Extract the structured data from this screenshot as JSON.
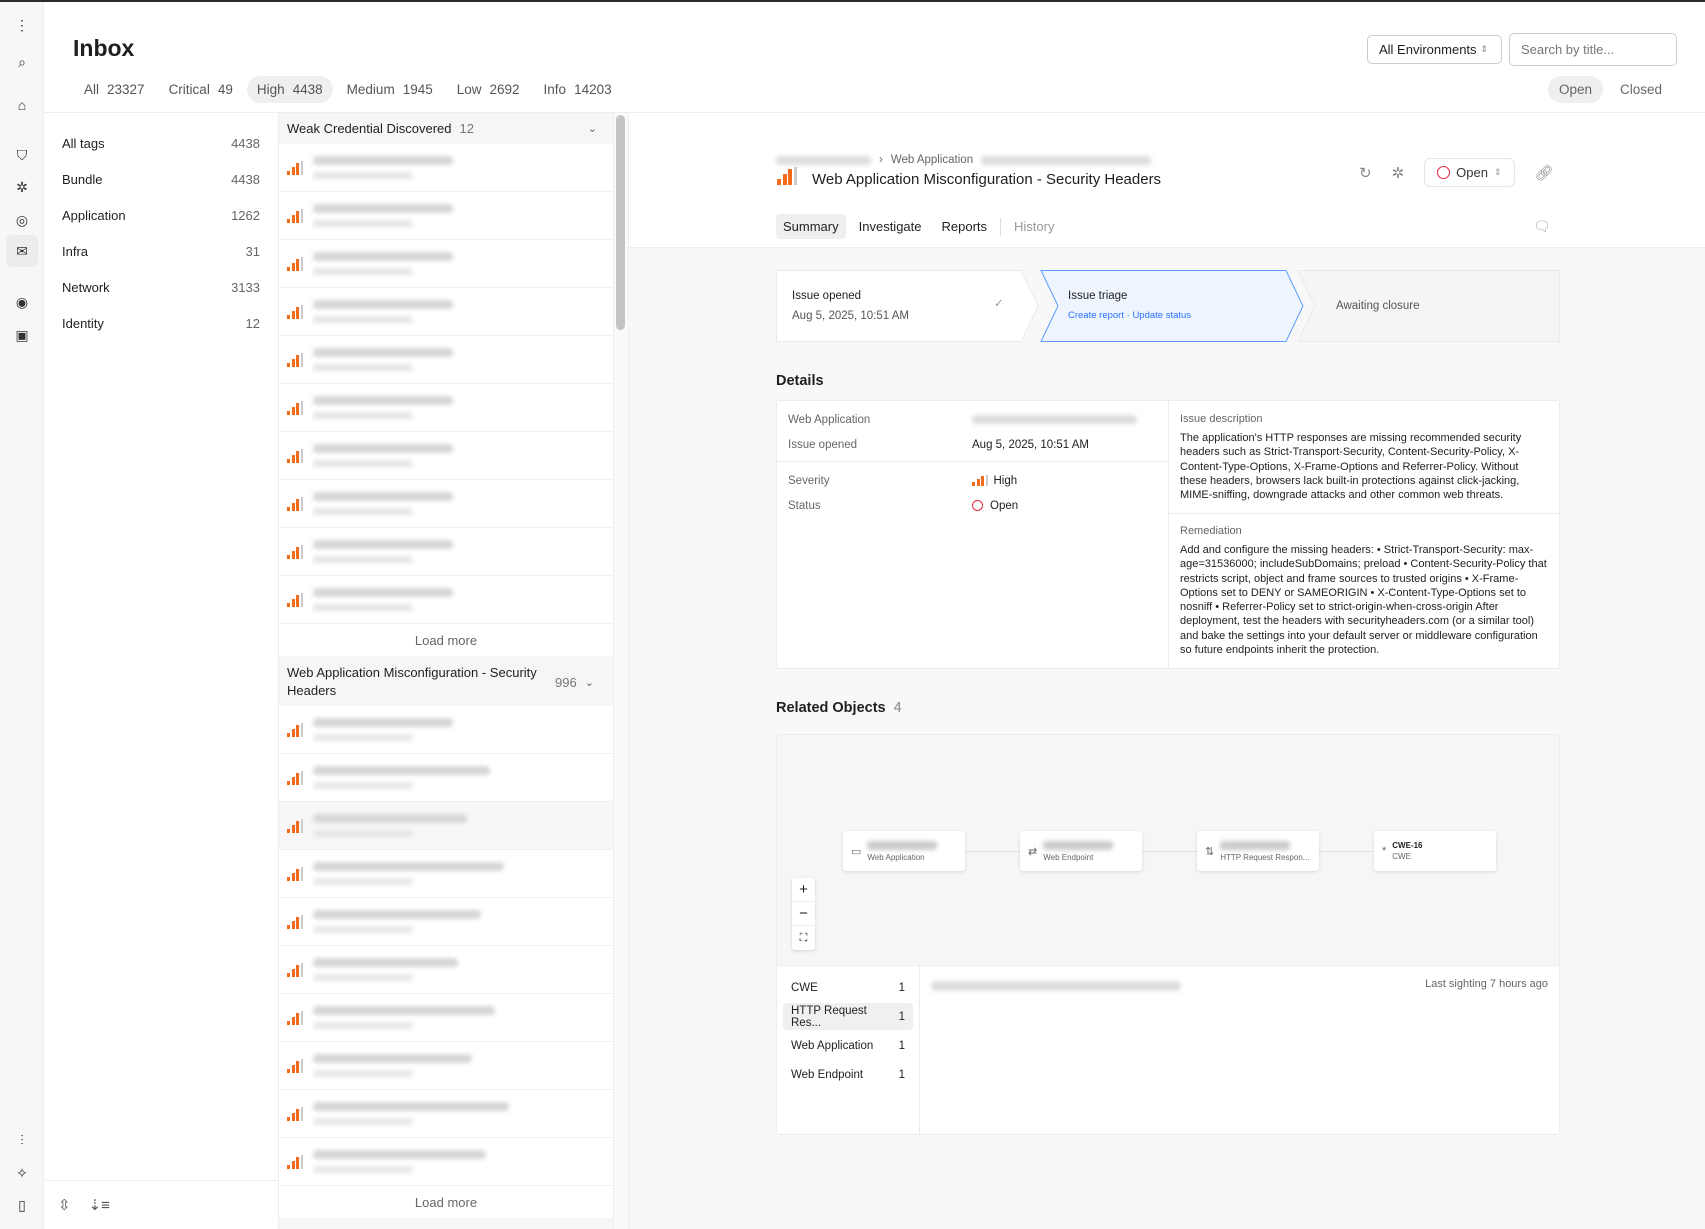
{
  "header": {
    "title": "Inbox",
    "environment": "All Environments",
    "search_placeholder": "Search by title...",
    "open_label": "Open",
    "closed_label": "Closed"
  },
  "severity_tabs": [
    {
      "label": "All",
      "count": "23327"
    },
    {
      "label": "Critical",
      "count": "49"
    },
    {
      "label": "High",
      "count": "4438"
    },
    {
      "label": "Medium",
      "count": "1945"
    },
    {
      "label": "Low",
      "count": "2692"
    },
    {
      "label": "Info",
      "count": "14203"
    }
  ],
  "tags": [
    {
      "label": "All tags",
      "count": "4438"
    },
    {
      "label": "Bundle",
      "count": "4438"
    },
    {
      "label": "Application",
      "count": "1262"
    },
    {
      "label": "Infra",
      "count": "31"
    },
    {
      "label": "Network",
      "count": "3133"
    },
    {
      "label": "Identity",
      "count": "12"
    }
  ],
  "groups": [
    {
      "title": "Weak Credential Discovered",
      "count": "12",
      "load_more": "Load more"
    },
    {
      "title": "Web Application Misconfiguration - Security Headers",
      "count": "996",
      "load_more": "Load more"
    }
  ],
  "colors": {
    "severity_high": "#f26b1d",
    "status_open": "#e2263f",
    "link": "#2970ff"
  },
  "detail": {
    "breadcrumb": "Web Application",
    "title": "Web Application Misconfiguration - Security Headers",
    "status": "Open",
    "tabs": [
      "Summary",
      "Investigate",
      "Reports",
      "History"
    ],
    "steps": {
      "opened_label": "Issue opened",
      "opened_date": "Aug 5, 2025, 10:51 AM",
      "triage_label": "Issue triage",
      "create_report": "Create report",
      "update_status": "Update status",
      "closure_label": "Awaiting closure"
    },
    "details_heading": "Details",
    "fields": {
      "web_app_label": "Web Application",
      "issue_opened_label": "Issue opened",
      "issue_opened_value": "Aug 5, 2025, 10:51 AM",
      "severity_label": "Severity",
      "severity_value": "High",
      "status_label": "Status",
      "status_value": "Open"
    },
    "description_label": "Issue description",
    "description": "The application's HTTP responses are missing recommended security headers such as Strict-Transport-Security, Content-Security-Policy, X-Content-Type-Options, X-Frame-Options and Referrer-Policy. Without these headers, browsers lack built-in protections against click-jacking, MIME-sniffing, downgrade attacks and other common web threats.",
    "remediation_label": "Remediation",
    "remediation": "Add and configure the missing headers: • Strict-Transport-Security: max-age=31536000; includeSubDomains; preload • Content-Security-Policy that restricts script, object and frame sources to trusted origins • X-Frame-Options set to DENY or SAMEORIGIN • X-Content-Type-Options set to nosniff • Referrer-Policy set to strict-origin-when-cross-origin After deployment, test the headers with securityheaders.com (or a similar tool) and bake the settings into your default server or middleware configuration so future endpoints inherit the protection.",
    "related_heading": "Related Objects",
    "related_count": "4",
    "graph_nodes": [
      {
        "type": "Web Application"
      },
      {
        "type": "Web Endpoint"
      },
      {
        "type": "HTTP Request Respon..."
      },
      {
        "title": "CWE-16",
        "type": "CWE"
      }
    ],
    "related_types": [
      {
        "label": "CWE",
        "count": "1"
      },
      {
        "label": "HTTP Request Res...",
        "count": "1"
      },
      {
        "label": "Web Application",
        "count": "1"
      },
      {
        "label": "Web Endpoint",
        "count": "1"
      }
    ],
    "last_sighting": "Last sighting 7 hours ago"
  }
}
